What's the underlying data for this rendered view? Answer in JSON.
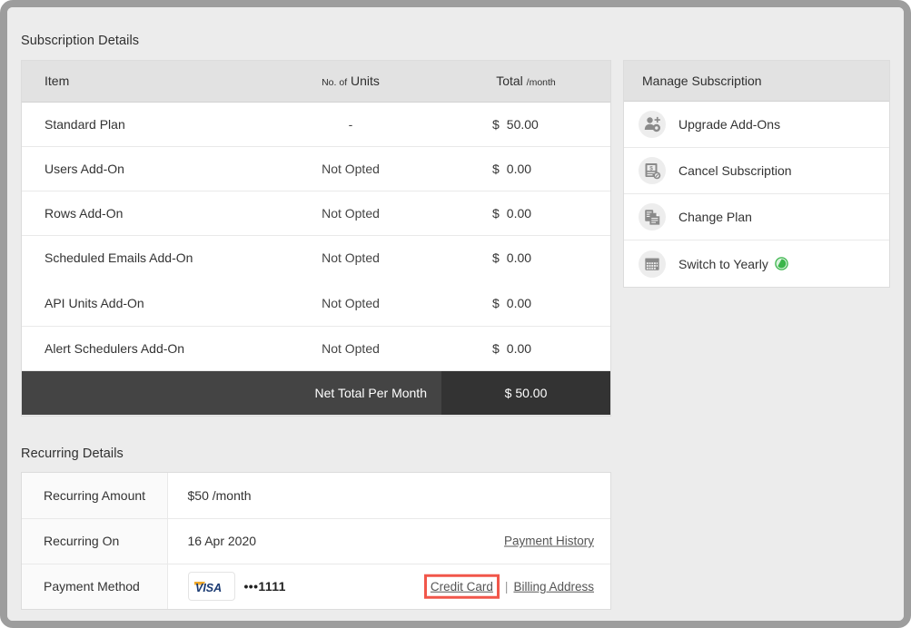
{
  "subscription": {
    "section_title": "Subscription Details",
    "columns": {
      "item": "Item",
      "units_small": "No. of",
      "units_main": "Units",
      "total_main": "Total",
      "total_small": "/month"
    },
    "rows": [
      {
        "item": "Standard Plan",
        "units": "-",
        "currency": "$",
        "amount": "50.00"
      },
      {
        "item": "Users Add-On",
        "units": "Not Opted",
        "currency": "$",
        "amount": "0.00"
      },
      {
        "item": "Rows Add-On",
        "units": "Not Opted",
        "currency": "$",
        "amount": "0.00"
      },
      {
        "item": "Scheduled Emails Add-On",
        "units": "Not Opted",
        "currency": "$",
        "amount": "0.00"
      },
      {
        "item": "API Units Add-On",
        "units": "Not Opted",
        "currency": "$",
        "amount": "0.00"
      },
      {
        "item": "Alert Schedulers Add-On",
        "units": "Not Opted",
        "currency": "$",
        "amount": "0.00"
      }
    ],
    "total": {
      "label": "Net Total Per Month",
      "value": "$ 50.00"
    }
  },
  "manage": {
    "header": "Manage Subscription",
    "items": [
      {
        "label": "Upgrade Add-Ons",
        "icon": "user-add-icon",
        "badge": ""
      },
      {
        "label": "Cancel Subscription",
        "icon": "invoice-cancel-icon",
        "badge": ""
      },
      {
        "label": "Change Plan",
        "icon": "documents-icon",
        "badge": ""
      },
      {
        "label": "Switch to Yearly",
        "icon": "calendar-icon",
        "badge": "yearly-offer-badge"
      }
    ]
  },
  "recurring": {
    "section_title": "Recurring Details",
    "amount_label": "Recurring Amount",
    "amount_value": "$50 /month",
    "on_label": "Recurring On",
    "on_value": "16 Apr 2020",
    "payment_history_link": "Payment History",
    "method_label": "Payment Method",
    "card_brand": "VISA",
    "card_masked": "•••1111",
    "credit_card_link": "Credit Card",
    "separator": "|",
    "billing_address_link": "Billing Address"
  },
  "colors": {
    "highlight": "#f1564a",
    "total_bar": "#444444",
    "total_value_bar": "#333333",
    "header_bg": "#e2e2e2",
    "page_bg": "#ececec",
    "badge_green": "#3ab54a"
  }
}
